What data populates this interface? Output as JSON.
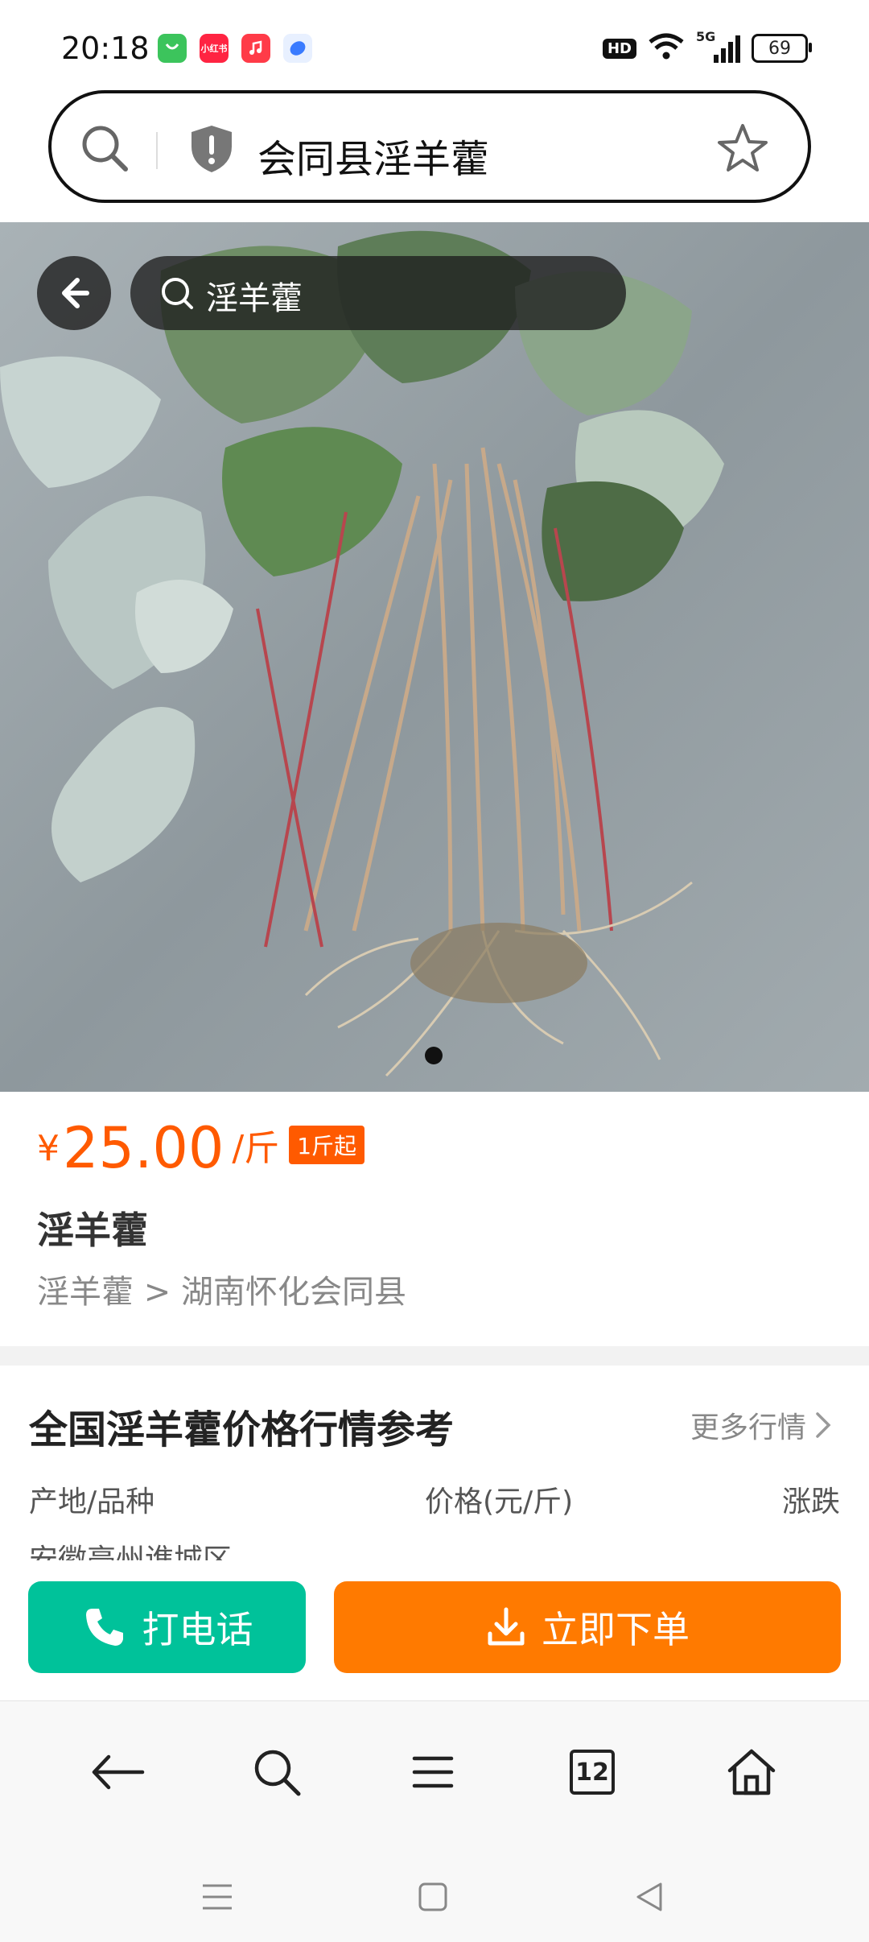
{
  "status_bar": {
    "time": "20:18",
    "apps": [
      "leaf-app-icon",
      "xiaohongshu-icon",
      "music-icon",
      "ball-icon"
    ],
    "xiaohongshu_label": "小红书",
    "hd": "HD",
    "network": "5G",
    "battery": "69"
  },
  "browser": {
    "url_text": "会同县淫羊藿"
  },
  "image_overlay": {
    "search_text": "淫羊藿"
  },
  "product": {
    "currency": "¥",
    "price": "25.00",
    "unit": "/斤",
    "min_order": "1斤起",
    "title": "淫羊藿",
    "breadcrumb": "淫羊藿 > 湖南怀化会同县"
  },
  "market": {
    "title": "全国淫羊藿价格行情参考",
    "more_label": "更多行情",
    "columns": [
      "产地/品种",
      "价格(元/斤)",
      "涨跌"
    ],
    "first_row_partial": "安徽亳州谯城区"
  },
  "actions": {
    "call_label": "打电话",
    "order_label": "立即下单"
  },
  "bottom_nav": {
    "tab_count": "12"
  },
  "colors": {
    "price": "#ff5a00",
    "call_button": "#00c29a",
    "order_button": "#ff7a00"
  }
}
